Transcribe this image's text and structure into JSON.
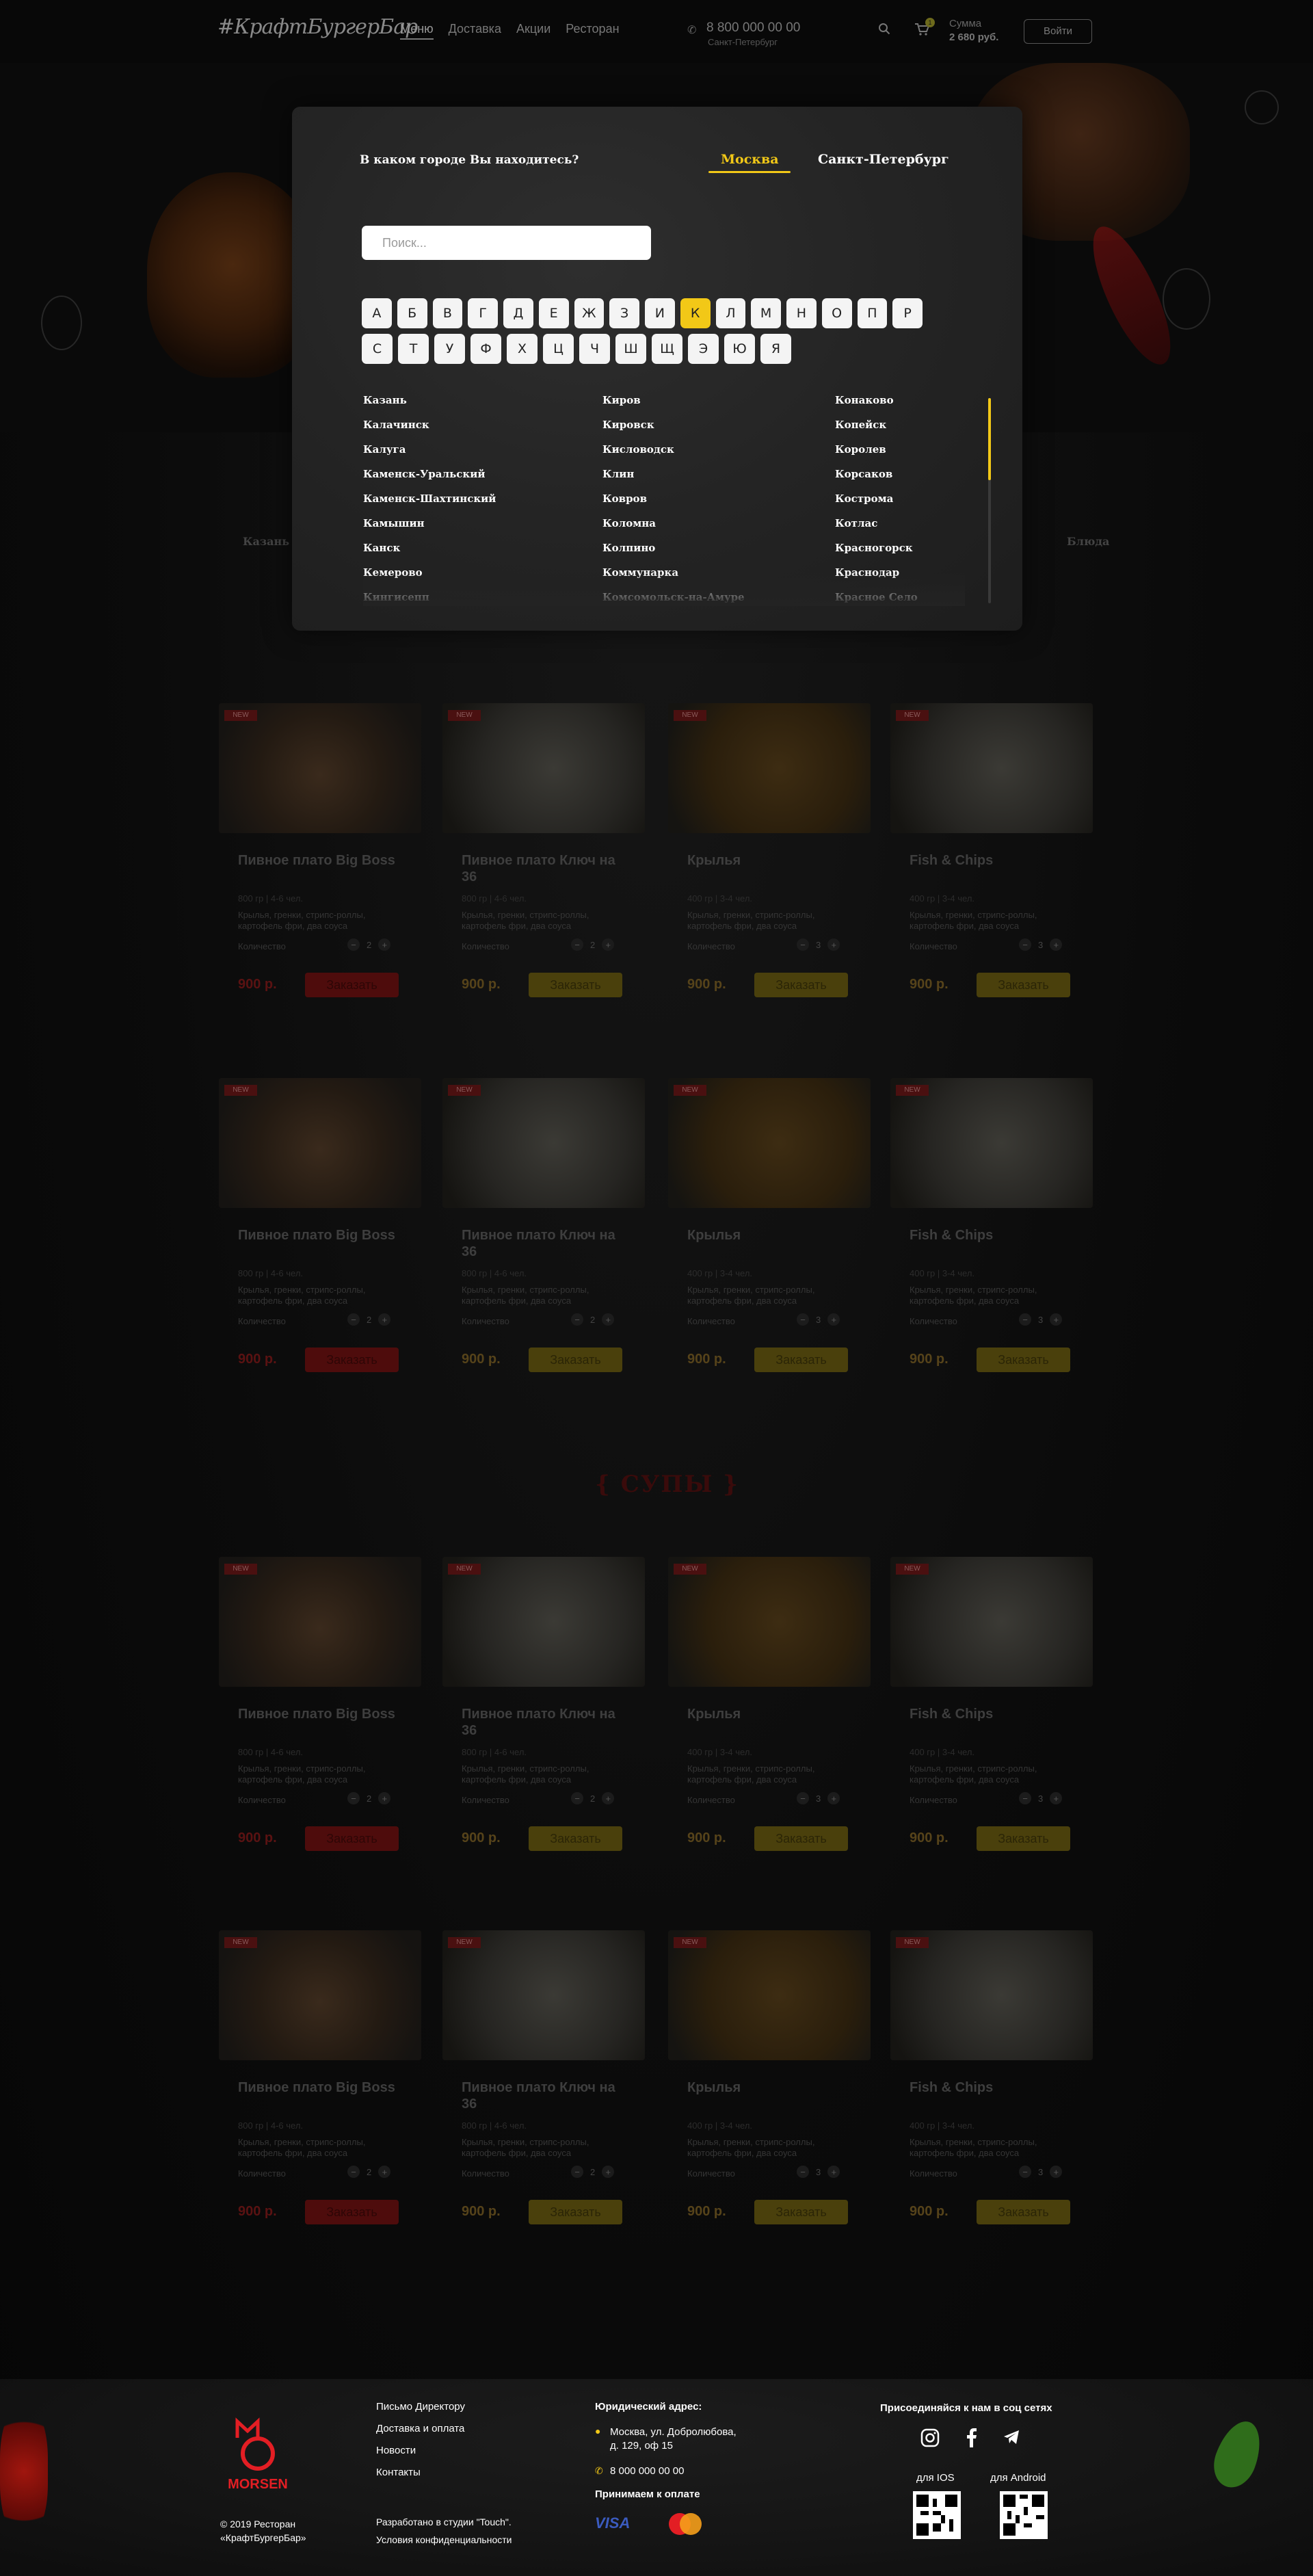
{
  "header": {
    "logo": "#КрафтБургерБар",
    "nav": [
      "Меню",
      "Доставка",
      "Акции",
      "Ресторан"
    ],
    "phone": "8 800 000 00 00",
    "phone_city": "Санкт-Петербург",
    "cart_count": "1",
    "sum_label": "Сумма",
    "sum_value": "2 680 руб.",
    "login": "Войти"
  },
  "modal": {
    "question": "В каком городе Вы находитесь?",
    "cities_top": [
      "Москва",
      "Санкт-Петербург"
    ],
    "search_placeholder": "Поиск...",
    "letters_row1": [
      "А",
      "Б",
      "В",
      "Г",
      "Д",
      "Е",
      "Ж",
      "З",
      "И",
      "К",
      "Л",
      "М",
      "Н",
      "О",
      "П",
      "Р"
    ],
    "letters_row2": [
      "С",
      "Т",
      "У",
      "Ф",
      "Х",
      "Ц",
      "Ч",
      "Ш",
      "Щ",
      "Э",
      "Ю",
      "Я"
    ],
    "selected_letter": "К",
    "col1": [
      "Казань",
      "Калачинск",
      "Калуга",
      "Каменск-Уральский",
      "Каменск-Шахтинский",
      "Камышин",
      "Канск",
      "Кемерово",
      "Кингисепп"
    ],
    "col2": [
      "Киров",
      "Кировск",
      "Кисловодск",
      "Клин",
      "Ковров",
      "Коломна",
      "Колпино",
      "Коммунарка",
      "Комсомольск-на-Амуре"
    ],
    "col3": [
      "Конаково",
      "Копейск",
      "Королев",
      "Корсаков",
      "Кострома",
      "Котлас",
      "Красногорск",
      "Краснодар",
      "Красное Село"
    ]
  },
  "behind": {
    "categories": [
      "Казань",
      "Блюда"
    ]
  },
  "section_title": "{ СУПЫ }",
  "card_common": {
    "badge": "NEW",
    "qty_label": "Количество",
    "order": "Заказать",
    "minus": "−",
    "plus": "+"
  },
  "products": [
    {
      "title": "Пивное плато Big Boss",
      "weight": "800 гр | 4-6 чел.",
      "desc": "Крылья, гренки, стрипс-роллы, картофель фри, два соуса",
      "qty": "2",
      "price": "900 р."
    },
    {
      "title": "Пивное плато Ключ на 36",
      "weight": "800 гр | 4-6 чел.",
      "desc": "Крылья, гренки, стрипс-роллы, картофель фри, два соуса",
      "qty": "2",
      "price": "900 р."
    },
    {
      "title": "Крылья",
      "weight": "400 гр | 3-4 чел.",
      "desc": "Крылья, гренки, стрипс-роллы, картофель фри, два соуса",
      "qty": "3",
      "price": "900 р."
    },
    {
      "title": "Fish & Chips",
      "weight": "400 гр | 3-4 чел.",
      "desc": "Крылья, гренки, стрипс-роллы, картофель фри, два соуса",
      "qty": "3",
      "price": "900 р."
    }
  ],
  "footer": {
    "brand": "MORSEN",
    "copyright_1": "© 2019 Ресторан",
    "copyright_2": "«КрафтБургерБар»",
    "links": [
      "Письмо Директору",
      "Доставка и оплата",
      "Новости",
      "Контакты"
    ],
    "studio": "Разработано в студии \"Touch\".",
    "privacy": "Условия конфиденциальности",
    "address_title": "Юридический адрес:",
    "address_1": "Москва, ул. Добролюбова,",
    "address_2": "д. 129, оф 15",
    "phone": "8 000 000 00 00",
    "pay_title": "Принимаем к оплате",
    "visa": "VISA",
    "social_title": "Присоединяйся к нам в соц сетях",
    "ios": "для IOS",
    "android": "для Android"
  }
}
